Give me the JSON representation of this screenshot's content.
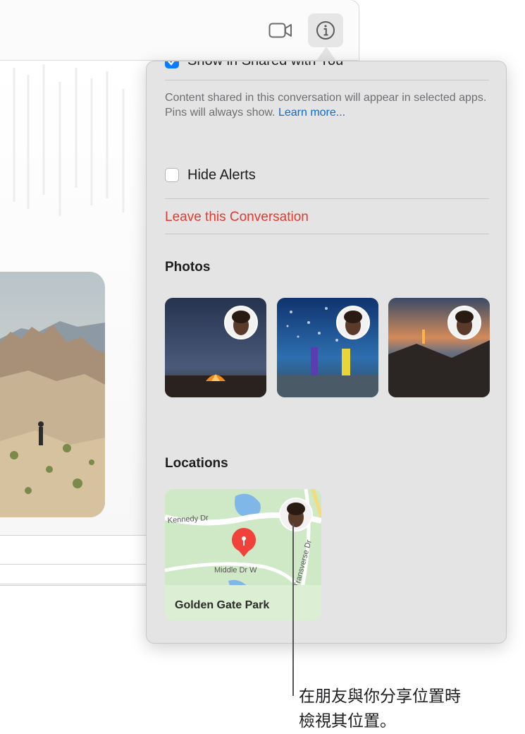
{
  "popover": {
    "top_checkbox_label": "Show in Shared with You",
    "description": "Content shared in this conversation will appear in selected apps. Pins will always show.",
    "learn_more": "Learn more...",
    "hide_alerts_label": "Hide Alerts",
    "leave_label": "Leave this Conversation",
    "photos_title": "Photos",
    "locations_title": "Locations",
    "location_name": "Golden Gate Park",
    "map_streets": [
      "Kennedy Dr",
      "Middle Dr W",
      "Transverse Dr"
    ]
  },
  "callout": {
    "line1": "在朋友與你分享位置時",
    "line2": "檢視其位置。"
  },
  "colors": {
    "accent": "#0a7aff",
    "destructive": "#e23a2f",
    "popover_bg": "#e4e4e4"
  },
  "icons": [
    "video-camera-icon",
    "info-icon",
    "checkmark-icon",
    "map-pin-icon",
    "memoji-avatar"
  ]
}
